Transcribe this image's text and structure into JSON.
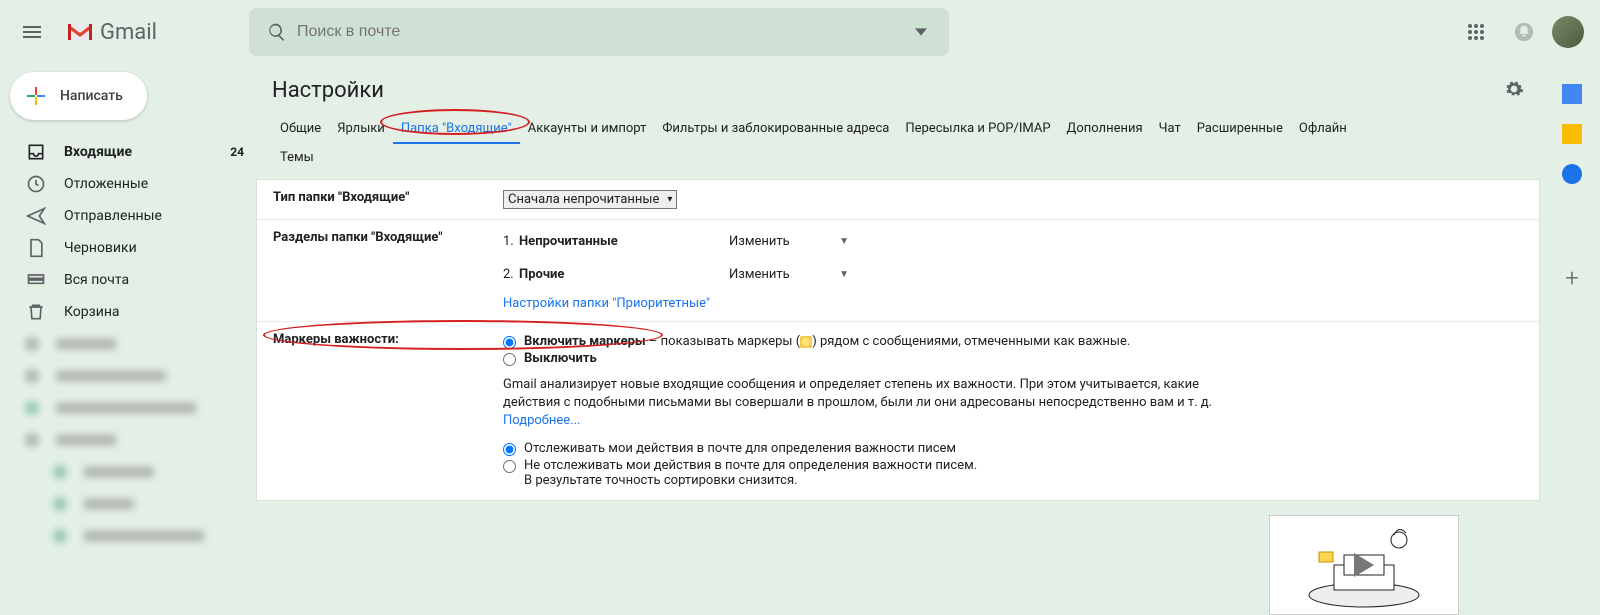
{
  "header": {
    "brand": "Gmail",
    "search_placeholder": "Поиск в почте"
  },
  "sidebar": {
    "compose": "Написать",
    "items": [
      {
        "label": "Входящие",
        "count": "24",
        "active": true
      },
      {
        "label": "Отложенные"
      },
      {
        "label": "Отправленные"
      },
      {
        "label": "Черновики"
      },
      {
        "label": "Вся почта"
      },
      {
        "label": "Корзина"
      }
    ]
  },
  "main": {
    "title": "Настройки",
    "tabs": [
      "Общие",
      "Ярлыки",
      "Папка \"Входящие\"",
      "Аккаунты и импорт",
      "Фильтры и заблокированные адреса",
      "Пересылка и POP/IMAP",
      "Дополнения",
      "Чат",
      "Расширенные",
      "Офлайн",
      "Темы"
    ],
    "active_tab": 2
  },
  "settings": {
    "inbox_type_label": "Тип папки \"Входящие\"",
    "inbox_type_value": "Сначала непрочитанные",
    "sections_label": "Разделы папки \"Входящие\"",
    "sections": [
      {
        "n": "1.",
        "name": "Непрочитанные",
        "action": "Изменить"
      },
      {
        "n": "2.",
        "name": "Прочие",
        "action": "Изменить"
      }
    ],
    "priority_link": "Настройки папки \"Приоритетные\"",
    "markers_label": "Маркеры важности:",
    "marker_on": "Включить маркеры",
    "marker_on_tail_a": " – показывать маркеры (",
    "marker_on_tail_b": ") рядом с сообщениями, отмеченными как важные.",
    "marker_off": "Выключить",
    "desc_text": "Gmail анализирует новые входящие сообщения и определяет степень их важности. При этом учитывается, какие действия с подобными письмами вы совершали в прошлом, были ли они адресованы непосредственно вам и т. д. ",
    "learn_more": "Подробнее...",
    "track_on": "Отслеживать мои действия в почте для определения важности писем",
    "track_off": "Не отслеживать мои действия в почте для определения важности писем.",
    "track_off_tail": "В результате точность сортировки снизится."
  }
}
